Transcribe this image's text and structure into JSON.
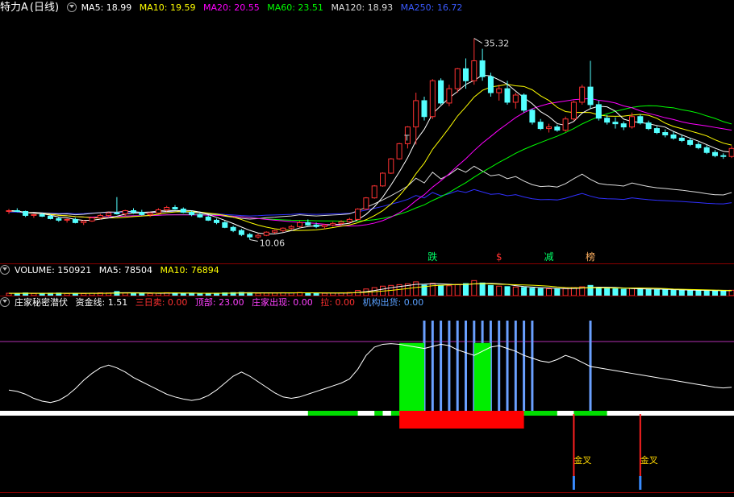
{
  "price_header": {
    "name": "特力A",
    "period": "(日线)",
    "ma5": "MA5: 18.99",
    "ma10": "MA10: 19.59",
    "ma20": "MA20: 20.55",
    "ma60": "MA60: 23.51",
    "ma120": "MA120: 18.93",
    "ma250": "MA250: 16.72"
  },
  "volume_header": {
    "volume": "VOLUME: 150921",
    "ma5": "MA5: 78504",
    "ma10": "MA10: 76894"
  },
  "indicator_header": {
    "name": "庄家秘密潜伏",
    "fund_line": "资金线: 1.51",
    "three_day_sell": "三日卖: 0.00",
    "top": "顶部: 23.00",
    "dealer_out": "庄家出现: 0.00",
    "pull": "拉: 0.00",
    "inst_out": "机构出货: 0.00"
  },
  "colors": {
    "up": "#ff3232",
    "down": "#54ffff",
    "ma5": "#ffffff",
    "ma10": "#ffff00",
    "ma20": "#ff00ff",
    "ma60": "#00ff00",
    "ma120": "#dddddd",
    "ma250": "#3030ff",
    "separator": "#8b0000"
  },
  "chart_data": [
    {
      "type": "candlestick",
      "title": "特力A (日线)",
      "annotations": [
        {
          "label": "35.32",
          "kind": "high"
        },
        {
          "label": "10.06",
          "kind": "low"
        },
        {
          "label": "T",
          "kind": "marker"
        }
      ],
      "signals": [
        "跌",
        "$",
        "减",
        "榜"
      ],
      "ohlc": [
        [
          13.6,
          13.9,
          13.3,
          13.7
        ],
        [
          13.7,
          14.0,
          13.5,
          13.6
        ],
        [
          13.6,
          13.7,
          12.9,
          13.1
        ],
        [
          13.1,
          13.3,
          12.8,
          13.2
        ],
        [
          13.2,
          13.4,
          12.9,
          13.0
        ],
        [
          13.0,
          13.2,
          12.6,
          12.7
        ],
        [
          12.7,
          12.9,
          12.3,
          12.5
        ],
        [
          12.5,
          12.7,
          12.2,
          12.6
        ],
        [
          12.6,
          12.8,
          12.1,
          12.2
        ],
        [
          12.2,
          12.5,
          11.9,
          12.4
        ],
        [
          12.4,
          12.9,
          12.3,
          12.8
        ],
        [
          12.8,
          13.3,
          12.6,
          13.1
        ],
        [
          13.1,
          13.5,
          12.9,
          13.4
        ],
        [
          13.4,
          15.4,
          13.2,
          13.3
        ],
        [
          13.3,
          13.8,
          13.0,
          13.7
        ],
        [
          13.7,
          14.0,
          13.3,
          13.5
        ],
        [
          13.5,
          13.8,
          13.1,
          13.2
        ],
        [
          13.2,
          13.5,
          12.9,
          13.4
        ],
        [
          13.4,
          14.0,
          13.3,
          13.8
        ],
        [
          13.8,
          14.3,
          13.6,
          14.1
        ],
        [
          14.1,
          14.4,
          13.8,
          13.9
        ],
        [
          13.9,
          14.1,
          13.4,
          13.5
        ],
        [
          13.5,
          13.7,
          13.0,
          13.2
        ],
        [
          13.2,
          13.4,
          12.8,
          12.9
        ],
        [
          12.9,
          13.1,
          12.4,
          12.5
        ],
        [
          12.5,
          12.7,
          12.0,
          12.2
        ],
        [
          12.2,
          12.4,
          11.5,
          11.6
        ],
        [
          11.6,
          11.8,
          11.0,
          11.2
        ],
        [
          11.2,
          11.4,
          10.5,
          10.7
        ],
        [
          10.7,
          10.9,
          10.06,
          10.4
        ],
        [
          10.4,
          10.8,
          10.2,
          10.6
        ],
        [
          10.6,
          11.1,
          10.5,
          11.0
        ],
        [
          11.0,
          11.3,
          10.8,
          11.2
        ],
        [
          11.2,
          11.6,
          11.0,
          11.5
        ],
        [
          11.5,
          11.9,
          11.3,
          11.7
        ],
        [
          11.7,
          12.4,
          11.6,
          12.2
        ],
        [
          12.2,
          12.6,
          11.8,
          11.9
        ],
        [
          11.9,
          12.2,
          11.5,
          11.7
        ],
        [
          11.7,
          12.0,
          11.4,
          11.9
        ],
        [
          11.9,
          12.3,
          11.7,
          12.1
        ],
        [
          12.1,
          12.5,
          11.9,
          12.3
        ],
        [
          12.3,
          12.8,
          12.2,
          12.6
        ],
        [
          12.6,
          14.0,
          12.5,
          13.9
        ],
        [
          13.9,
          15.4,
          13.8,
          15.3
        ],
        [
          15.3,
          16.9,
          15.2,
          16.8
        ],
        [
          16.8,
          18.5,
          16.7,
          18.4
        ],
        [
          18.4,
          20.3,
          18.3,
          20.2
        ],
        [
          20.2,
          22.2,
          20.1,
          22.1
        ],
        [
          22.1,
          24.3,
          21.5,
          24.2
        ],
        [
          24.2,
          28.5,
          22.0,
          27.5
        ],
        [
          27.5,
          28.0,
          25.0,
          25.5
        ],
        [
          25.5,
          30.2,
          25.2,
          30.0
        ],
        [
          30.0,
          30.3,
          27.0,
          27.2
        ],
        [
          27.2,
          29.5,
          26.8,
          29.0
        ],
        [
          29.0,
          31.6,
          28.5,
          31.5
        ],
        [
          31.5,
          32.8,
          29.0,
          30.0
        ],
        [
          30.0,
          35.32,
          29.5,
          32.5
        ],
        [
          32.5,
          34.0,
          30.0,
          30.5
        ],
        [
          30.5,
          31.0,
          28.0,
          28.5
        ],
        [
          28.5,
          29.5,
          27.5,
          29.0
        ],
        [
          29.0,
          30.0,
          27.0,
          27.3
        ],
        [
          27.3,
          28.5,
          26.5,
          28.2
        ],
        [
          28.2,
          28.4,
          26.0,
          26.3
        ],
        [
          26.3,
          26.5,
          24.5,
          24.8
        ],
        [
          24.8,
          25.2,
          23.8,
          24.0
        ],
        [
          24.0,
          24.6,
          23.5,
          24.2
        ],
        [
          24.2,
          24.5,
          23.6,
          23.8
        ],
        [
          23.8,
          25.5,
          23.6,
          25.2
        ],
        [
          25.2,
          27.5,
          25.0,
          27.3
        ],
        [
          27.3,
          29.5,
          27.0,
          29.2
        ],
        [
          29.2,
          32.5,
          26.5,
          27.0
        ],
        [
          27.0,
          27.5,
          25.0,
          25.3
        ],
        [
          25.3,
          25.7,
          24.5,
          24.8
        ],
        [
          24.8,
          25.4,
          24.0,
          24.6
        ],
        [
          24.6,
          24.9,
          23.8,
          24.2
        ],
        [
          24.2,
          26.0,
          24.0,
          25.5
        ],
        [
          25.5,
          25.8,
          24.5,
          24.7
        ],
        [
          24.7,
          25.0,
          23.8,
          24.0
        ],
        [
          24.0,
          24.3,
          23.3,
          23.5
        ],
        [
          23.5,
          23.9,
          22.9,
          23.2
        ],
        [
          23.2,
          23.6,
          22.6,
          22.8
        ],
        [
          22.8,
          23.2,
          22.3,
          22.5
        ],
        [
          22.5,
          22.8,
          21.8,
          22.0
        ],
        [
          22.0,
          22.3,
          21.4,
          21.6
        ],
        [
          21.6,
          21.9,
          20.8,
          21.0
        ],
        [
          21.0,
          21.3,
          20.4,
          20.6
        ],
        [
          20.6,
          20.9,
          20.2,
          20.5
        ],
        [
          20.5,
          21.8,
          20.3,
          21.5
        ]
      ],
      "volume": [
        22,
        21,
        25,
        20,
        19,
        23,
        24,
        20,
        21,
        19,
        23,
        26,
        25,
        38,
        24,
        22,
        21,
        20,
        23,
        27,
        24,
        22,
        21,
        20,
        22,
        23,
        26,
        28,
        30,
        27,
        22,
        24,
        25,
        27,
        26,
        29,
        24,
        23,
        22,
        24,
        26,
        29,
        48,
        62,
        75,
        88,
        95,
        102,
        110,
        128,
        98,
        115,
        96,
        92,
        105,
        112,
        140,
        118,
        95,
        88,
        84,
        80,
        76,
        70,
        66,
        64,
        62,
        68,
        75,
        82,
        95,
        72,
        66,
        63,
        60,
        68,
        62,
        58,
        55,
        53,
        52,
        50,
        48,
        47,
        46,
        45,
        44,
        50
      ]
    },
    {
      "type": "line",
      "title": "庄家秘密潜伏",
      "series": [
        {
          "name": "资金线",
          "values": [
            30,
            28,
            24,
            18,
            14,
            12,
            15,
            22,
            32,
            44,
            54,
            62,
            66,
            62,
            56,
            48,
            42,
            36,
            30,
            24,
            20,
            17,
            15,
            17,
            22,
            30,
            40,
            50,
            56,
            50,
            42,
            34,
            26,
            20,
            18,
            20,
            24,
            28,
            32,
            36,
            40,
            46,
            60,
            80,
            92,
            96,
            97,
            96,
            94,
            92,
            90,
            93,
            96,
            94,
            88,
            84,
            80,
            86,
            92,
            94,
            90,
            86,
            80,
            76,
            72,
            70,
            74,
            80,
            76,
            70,
            64,
            62,
            60,
            58,
            56,
            54,
            52,
            50,
            48,
            46,
            44,
            42,
            40,
            38,
            36,
            34,
            33,
            34
          ]
        }
      ],
      "markers": [
        "金叉",
        "金叉"
      ]
    }
  ]
}
